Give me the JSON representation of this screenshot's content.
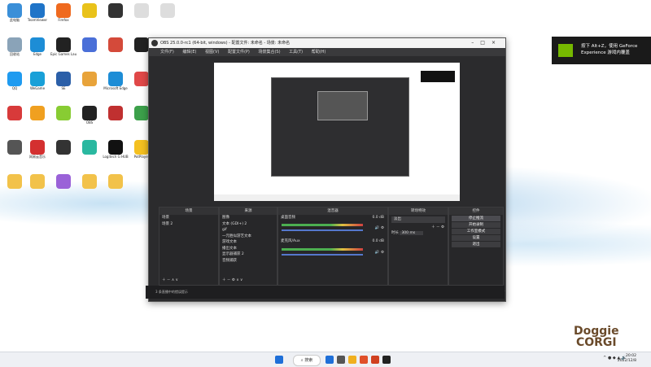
{
  "desktop": {
    "icons": [
      {
        "label": "此电脑",
        "color": "#3a8fd8"
      },
      {
        "label": "TeamViewer",
        "color": "#1f74c8"
      },
      {
        "label": "Firefox",
        "color": "#ef6a1f"
      },
      {
        "label": "",
        "color": "#e9c21a"
      },
      {
        "label": "",
        "color": "#333333"
      },
      {
        "label": "",
        "color": "#dddddd"
      },
      {
        "label": "",
        "color": "#dddddd"
      },
      {
        "label": "回收站",
        "color": "#8aa3b8"
      },
      {
        "label": "Edge",
        "color": "#1d8dd6"
      },
      {
        "label": "Epic Games Launcher",
        "color": "#222222"
      },
      {
        "label": "",
        "color": "#4a6fd8"
      },
      {
        "label": "",
        "color": "#d44a3a"
      },
      {
        "label": "",
        "color": "#222222"
      },
      {
        "label": "GeForce Experience",
        "color": "#76b900"
      },
      {
        "label": "QQ",
        "color": "#1f9bf0"
      },
      {
        "label": "WeGame",
        "color": "#19a0d8"
      },
      {
        "label": "SE",
        "color": "#2b5fa8"
      },
      {
        "label": "",
        "color": "#e8a33a"
      },
      {
        "label": "Microsoft Edge",
        "color": "#1d8dd6"
      },
      {
        "label": "",
        "color": "#e04848"
      },
      {
        "label": "Steam",
        "color": "#1b2838"
      },
      {
        "label": "",
        "color": "#d83a3a"
      },
      {
        "label": "",
        "color": "#f0a020"
      },
      {
        "label": "",
        "color": "#8c3"
      },
      {
        "label": "OBS",
        "color": "#222222"
      },
      {
        "label": "",
        "color": "#c03030"
      },
      {
        "label": "",
        "color": "#3ca04a"
      },
      {
        "label": "",
        "color": "#3a7bd8"
      },
      {
        "label": "",
        "color": "#555555"
      },
      {
        "label": "网易云音乐",
        "color": "#d43030"
      },
      {
        "label": "",
        "color": "#333333"
      },
      {
        "label": "",
        "color": "#2ab8a0"
      },
      {
        "label": "Logitech G HUB",
        "color": "#111111"
      },
      {
        "label": "PotPlayer",
        "color": "#f4c020"
      },
      {
        "label": "",
        "color": "#eeeeee"
      },
      {
        "label": "",
        "color": "#f2c24a"
      },
      {
        "label": "",
        "color": "#f2c24a"
      },
      {
        "label": "",
        "color": "#9a62d8"
      },
      {
        "label": "",
        "color": "#f2c24a"
      },
      {
        "label": "",
        "color": "#f2c24a"
      }
    ]
  },
  "obs": {
    "title": "OBS 25.0.0-rc1 (64-bit, windows) - 配置文件: 未命名 - 场景: 未命名",
    "menu": [
      "文件(F)",
      "编辑(E)",
      "视图(V)",
      "配置文件(P)",
      "场景集合(S)",
      "工具(T)",
      "帮助(H)"
    ],
    "docks": {
      "scenes": {
        "title": "场景",
        "items": [
          "场景",
          "场景 2"
        ]
      },
      "sources": {
        "title": "来源",
        "items": [
          "图像",
          "文本 (GDI+) 2",
          "gif",
          "一元胜似游艺文本",
          "游戏文本",
          "播出文本",
          "显示器捕获 2",
          "音频捕获"
        ]
      },
      "mixer": {
        "title": "混音器",
        "tracks": [
          {
            "name": "桌面音频",
            "db": "0.0 dB"
          },
          {
            "name": "麦克风/Aux",
            "db": "0.0 dB"
          }
        ]
      },
      "transitions": {
        "title": "转场特效",
        "type": "淡出",
        "duration_label": "时长",
        "duration": "300 ms"
      },
      "controls": {
        "title": "控件",
        "buttons": [
          "停止推流",
          "开始录制",
          "工作室模式",
          "设置",
          "退出"
        ]
      }
    },
    "status": {
      "live": "LIVE: 00:00:00",
      "rec": "REC: 00:00:00",
      "cpu": "CPU: 0.7%, 59.94 fps"
    },
    "bottom_msg": "3 条直播中的错误提示"
  },
  "notification": {
    "text": "按下 Alt+Z，使用 GeForce Experience 游戏内覆盖"
  },
  "watermark": {
    "line1": "Doggie",
    "line2": "CORGI"
  },
  "taskbar": {
    "search": "搜索",
    "time": "20:02",
    "date": "2022/12/8",
    "apps": [
      {
        "color": "#1e6fd8"
      },
      {
        "color": "#555555"
      },
      {
        "color": "#f0b020"
      },
      {
        "color": "#e0502a"
      },
      {
        "color": "#d04020"
      },
      {
        "color": "#222222"
      }
    ]
  }
}
